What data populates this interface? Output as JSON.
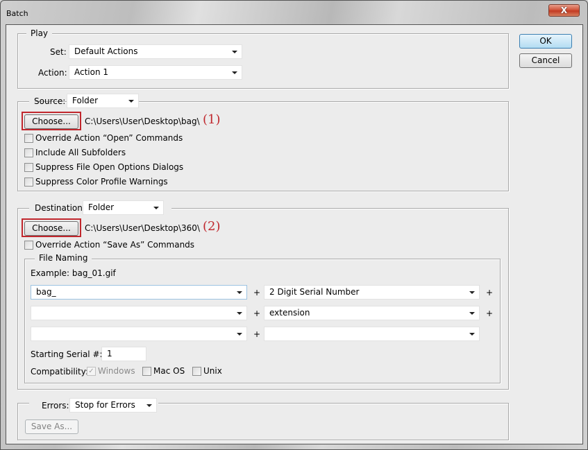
{
  "window": {
    "title": "Batch",
    "close_label": "X"
  },
  "buttons": {
    "ok": "OK",
    "cancel": "Cancel"
  },
  "play": {
    "legend": "Play",
    "set_label": "Set:",
    "set_value": "Default Actions",
    "action_label": "Action:",
    "action_value": "Action 1"
  },
  "source": {
    "label": "Source:",
    "value": "Folder",
    "choose_label": "Choose...",
    "path": "C:\\Users\\User\\Desktop\\bag\\",
    "annotation": "(1)",
    "highlight_color": "#c1272d",
    "options": [
      {
        "label": "Override Action “Open” Commands",
        "checked": false
      },
      {
        "label": "Include All Subfolders",
        "checked": false
      },
      {
        "label": "Suppress File Open Options Dialogs",
        "checked": false
      },
      {
        "label": "Suppress Color Profile Warnings",
        "checked": false
      }
    ]
  },
  "destination": {
    "label": "Destination:",
    "value": "Folder",
    "choose_label": "Choose...",
    "path": "C:\\Users\\User\\Desktop\\360\\",
    "annotation": "(2)",
    "override_label": "Override Action “Save As” Commands",
    "override_checked": false
  },
  "file_naming": {
    "legend": "File Naming",
    "example": "Example: bag_01.gif",
    "fields": [
      {
        "left": "bag_",
        "right": "2 Digit Serial Number"
      },
      {
        "left": "",
        "right": "extension"
      },
      {
        "left": "",
        "right": ""
      }
    ],
    "plus": "+",
    "serial_label": "Starting Serial #:",
    "serial_value": "1",
    "compat_label": "Compatibility:",
    "compat": [
      {
        "label": "Windows",
        "checked": true,
        "disabled": true,
        "mark": "✓"
      },
      {
        "label": "Mac OS",
        "checked": false
      },
      {
        "label": "Unix",
        "checked": false
      }
    ]
  },
  "errors": {
    "label": "Errors:",
    "value": "Stop for Errors",
    "save_as_label": "Save As..."
  }
}
